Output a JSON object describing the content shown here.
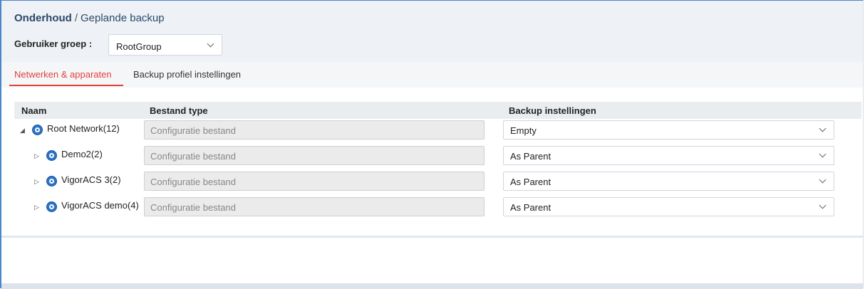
{
  "breadcrumb": {
    "section": "Onderhoud",
    "separator": "/",
    "page": "Geplande backup"
  },
  "user_group": {
    "label": "Gebruiker groep :",
    "value": "RootGroup"
  },
  "tabs": [
    {
      "label": "Netwerken & apparaten",
      "active": true
    },
    {
      "label": "Backup profiel instellingen",
      "active": false
    }
  ],
  "table": {
    "columns": {
      "name": "Naam",
      "file_type": "Bestand type",
      "backup": "Backup instellingen"
    },
    "rows": [
      {
        "name": "Root Network(12)",
        "expander": "◢",
        "file_type": "Configuratie bestand",
        "backup": "Empty"
      },
      {
        "name": "Demo2(2)",
        "expander": "▷",
        "file_type": "Configuratie bestand",
        "backup": "As Parent"
      },
      {
        "name": "VigorACS 3(2)",
        "expander": "▷",
        "file_type": "Configuratie bestand",
        "backup": "As Parent"
      },
      {
        "name": "VigorACS demo(4)",
        "expander": "▷",
        "file_type": "Configuratie bestand",
        "backup": "As Parent"
      }
    ]
  },
  "colors": {
    "accent": "#e0423c",
    "link": "#2b4968",
    "icon": "#2a73c6"
  },
  "icons": {
    "network": "network-icon",
    "dropdown": "chevron-down-icon"
  }
}
